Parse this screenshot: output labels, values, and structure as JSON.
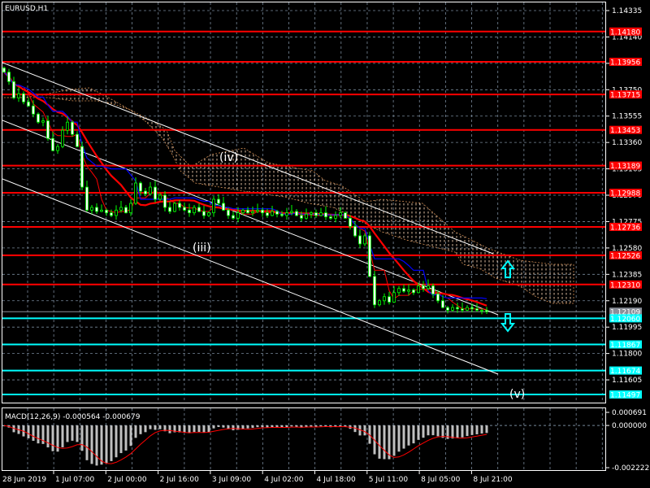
{
  "title": "EURUSD,H1",
  "colors": {
    "background": "#000000",
    "bull": "#00ff00",
    "grid": "#778899",
    "resistance": "#ff0000",
    "support": "#00ffff",
    "current": "#8a8f99",
    "channel": "#ffffff",
    "cloud": "#ffdab9"
  },
  "wave_labels": [
    "(iii)",
    "(iv)",
    "(v)"
  ],
  "chart_data": {
    "type": "candlestick",
    "symbol": "EURUSD",
    "timeframe": "H1",
    "price_range": [
      1.114,
      1.1442
    ],
    "price_ticks": [
      "1.14335",
      "1.14140",
      "1.13945",
      "1.13750",
      "1.13555",
      "1.13360",
      "1.13165",
      "1.12970",
      "1.12775",
      "1.12580",
      "1.12385",
      "1.12190",
      "1.11995",
      "1.11800",
      "1.11605"
    ],
    "time_labels": [
      "28 Jun 2019",
      "1 Jul 07:00",
      "2 Jul 00:00",
      "2 Jul 16:00",
      "3 Jul 09:00",
      "4 Jul 02:00",
      "4 Jul 18:00",
      "5 Jul 11:00",
      "8 Jul 05:00",
      "8 Jul 21:00"
    ],
    "resistance_levels": [
      "1.14180",
      "1.13956",
      "1.13715",
      "1.13453",
      "1.13189",
      "1.12988",
      "1.12736",
      "1.12526",
      "1.12310"
    ],
    "support_levels": [
      "1.12060",
      "1.11867",
      "1.11674",
      "1.11497"
    ],
    "current_price": "1.12109",
    "closes": [
      1.1388,
      1.1381,
      1.1369,
      1.1372,
      1.1366,
      1.1363,
      1.1357,
      1.1351,
      1.1352,
      1.1339,
      1.133,
      1.1333,
      1.1345,
      1.1351,
      1.1342,
      1.1333,
      1.1303,
      1.1286,
      1.1288,
      1.1285,
      1.1286,
      1.1284,
      1.1282,
      1.1286,
      1.1288,
      1.1284,
      1.1291,
      1.1306,
      1.13,
      1.1298,
      1.1303,
      1.1294,
      1.1297,
      1.1288,
      1.1285,
      1.1291,
      1.1288,
      1.1286,
      1.1284,
      1.1288,
      1.1285,
      1.1282,
      1.1284,
      1.1294,
      1.1291,
      1.1286,
      1.1282,
      1.128,
      1.1284,
      1.1286,
      1.1284,
      1.1285,
      1.1286,
      1.1284,
      1.1282,
      1.1285,
      1.1283,
      1.1282,
      1.1284,
      1.1285,
      1.1282,
      1.128,
      1.1283,
      1.1284,
      1.1282,
      1.1284,
      1.1281,
      1.128,
      1.1282,
      1.1284,
      1.128,
      1.1274,
      1.1267,
      1.1261,
      1.1267,
      1.1237,
      1.1216,
      1.1219,
      1.1222,
      1.1218,
      1.1225,
      1.1228,
      1.1226,
      1.1227,
      1.1225,
      1.123,
      1.1228,
      1.123,
      1.1224,
      1.1219,
      1.1214,
      1.1212,
      1.1214,
      1.1213,
      1.1212,
      1.1214,
      1.1213,
      1.1212,
      1.1212,
      1.1211
    ],
    "macd": {
      "label": "MACD(12,26,9) -0.000564 -0.000679",
      "axis_labels": [
        "0.000691",
        "0.000000",
        "-0.002222"
      ],
      "range": [
        -0.002222,
        0.000691
      ]
    }
  }
}
